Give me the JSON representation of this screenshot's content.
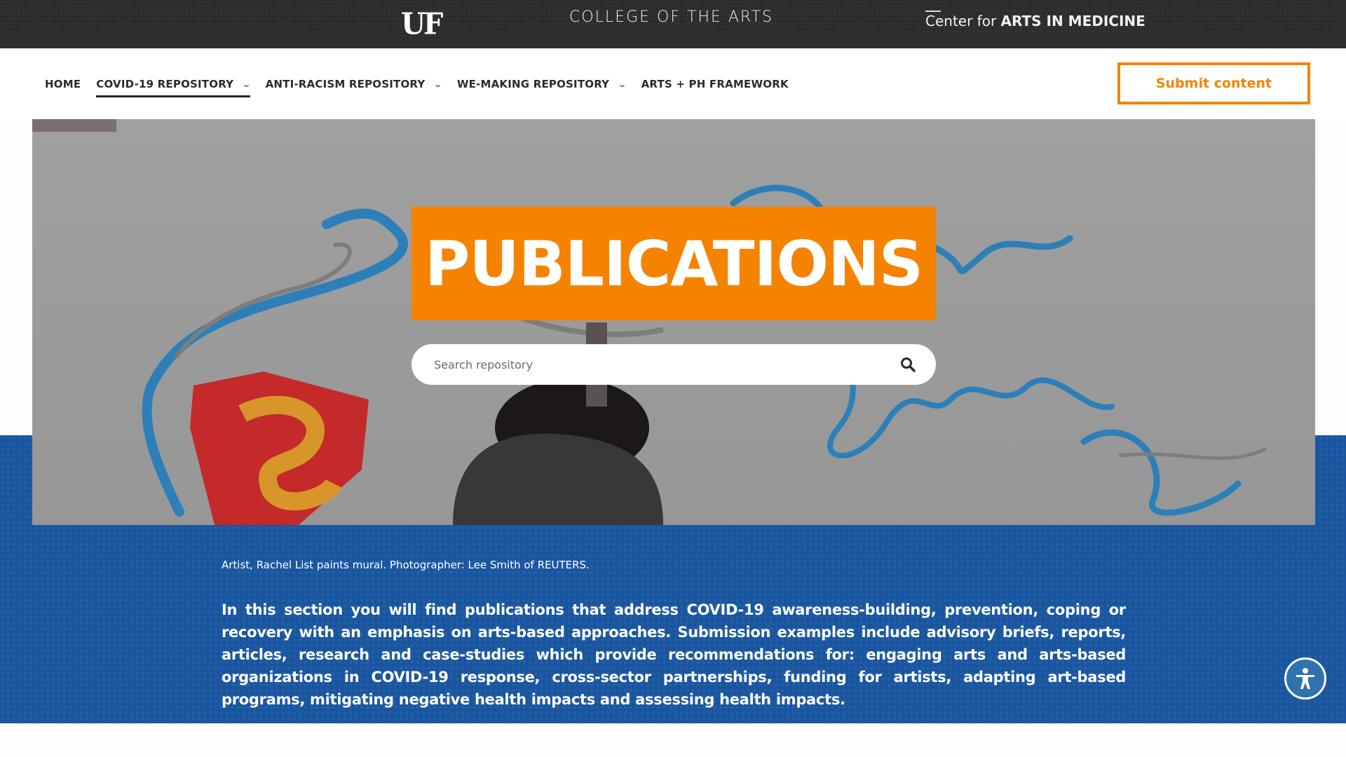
{
  "topbar": {
    "uf_logo": "UF",
    "college": "COLLEGE OF THE ARTS",
    "center_prefix": "Center for ",
    "center_name": "ARTS IN MEDICINE"
  },
  "nav": {
    "items": [
      {
        "label": "HOME",
        "has_dropdown": false,
        "active": false
      },
      {
        "label": "COVID-19 REPOSITORY",
        "has_dropdown": true,
        "active": true
      },
      {
        "label": "ANTI-RACISM REPOSITORY",
        "has_dropdown": true,
        "active": false
      },
      {
        "label": "WE-MAKING REPOSITORY",
        "has_dropdown": true,
        "active": false
      },
      {
        "label": "ARTS + PH FRAMEWORK",
        "has_dropdown": false,
        "active": false
      }
    ],
    "submit_label": "Submit content"
  },
  "hero": {
    "title": "PUBLICATIONS",
    "search_placeholder": "Search repository",
    "image_alt": "Mural of a superhero shield and the word Safe being painted by an artist"
  },
  "content": {
    "caption": "Artist, Rachel List paints mural. Photographer: Lee Smith of REUTERS.",
    "description": "In this section you will find publications that address COVID-19 awareness-building, prevention, coping or recovery with an emphasis on arts-based approaches. Submission examples include advisory briefs, reports, articles, research and case-studies which provide recommendations for: engaging arts and arts-based organizations in COVID-19 response, cross-sector partnerships, funding for artists, adapting art-based programs, mitigating negative health impacts and assessing health impacts."
  },
  "colors": {
    "accent_orange": "#f58300",
    "brand_blue": "#1a56a0",
    "topbar_dark": "#2e2d2e"
  },
  "icons": {
    "search": "search-icon",
    "chevron": "chevron-down-icon",
    "accessibility": "accessibility-icon"
  }
}
